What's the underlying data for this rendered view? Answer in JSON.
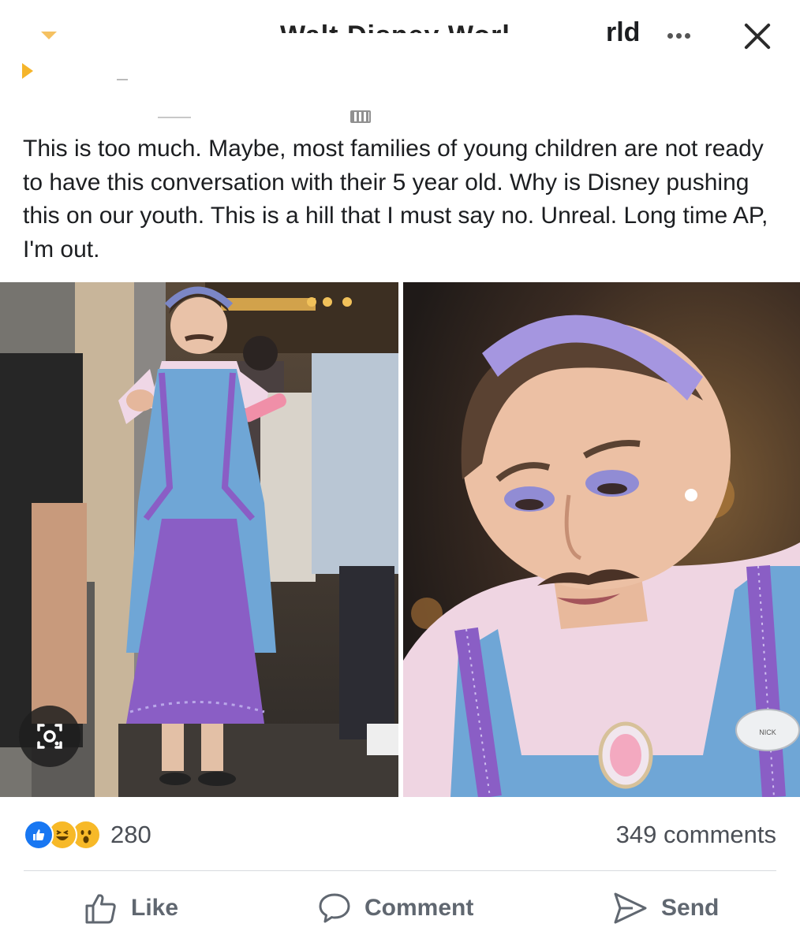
{
  "header": {
    "title": "rld",
    "cut_title": "Walt Disney World",
    "more_icon": "more-dots-icon",
    "close_icon": "close-icon",
    "audience_icon": "friends-audience-icon"
  },
  "post": {
    "text": "This is too much.  Maybe, most families of young children are not ready to have this conversation with their 5 year old. Why is Disney pushing this on our youth.  This is a hill that I must say no. Unreal.  Long time AP, I'm out."
  },
  "photos": [
    {
      "id": "left",
      "icon": "visual-search-icon"
    },
    {
      "id": "right"
    }
  ],
  "badge": {
    "name_tag": "NICK"
  },
  "reactions": {
    "icons": [
      "like-icon",
      "haha-icon",
      "wow-icon"
    ],
    "count": "280"
  },
  "comments": {
    "count_label": "349 comments"
  },
  "actions": {
    "like": "Like",
    "comment": "Comment",
    "send": "Send"
  },
  "colors": {
    "accent": "#1877f2",
    "reaction_yellow": "#f7b928",
    "action_gray": "#606770",
    "dress_blue": "#6fa6d6",
    "skirt_purple": "#8a5ec5",
    "headband": "#a596e0"
  }
}
